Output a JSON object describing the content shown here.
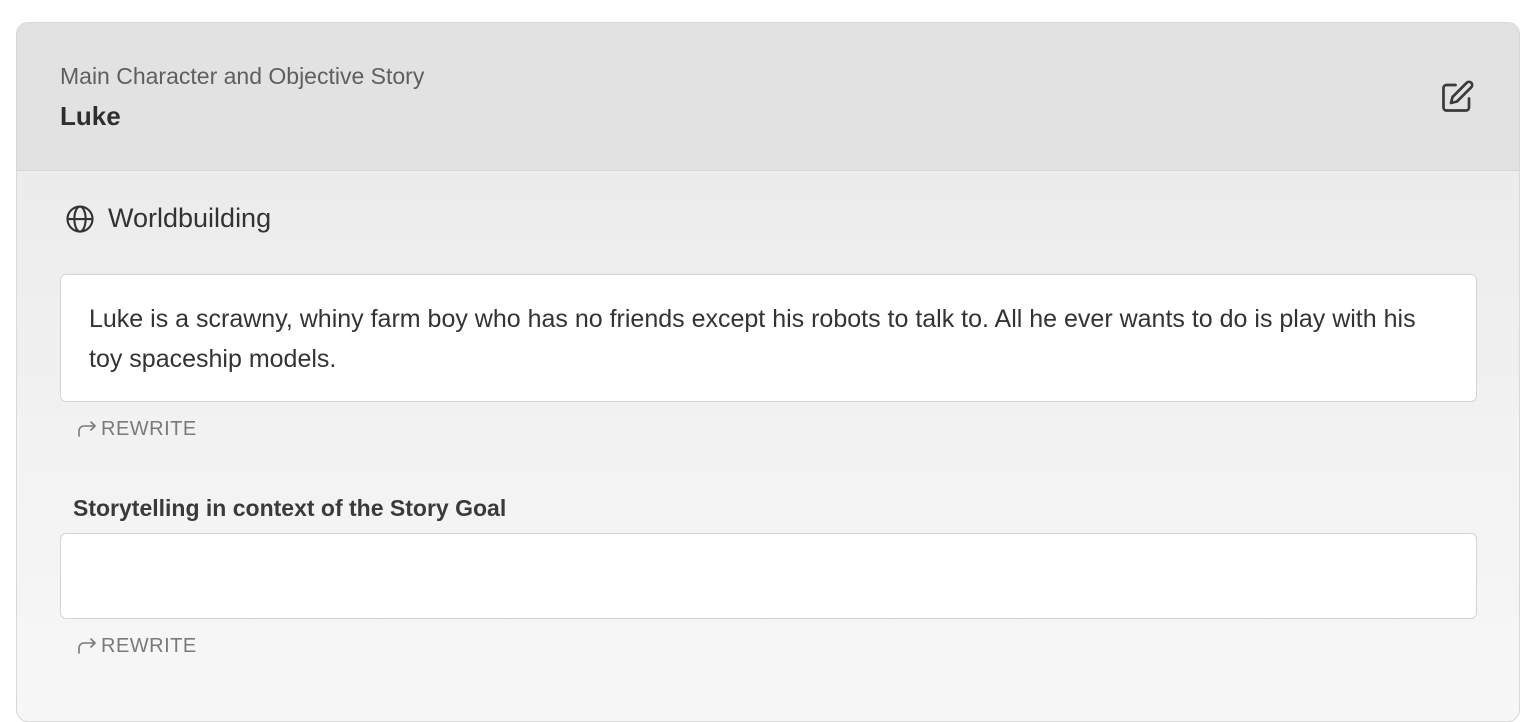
{
  "header": {
    "subtitle": "Main Character and Objective Story",
    "title": "Luke",
    "edit_icon": "edit-icon"
  },
  "worldbuilding": {
    "icon": "globe-icon",
    "label": "Worldbuilding",
    "text": "Luke is a scrawny, whiny farm boy who has no friends except his robots to talk to. All he ever wants to do is play with his toy spaceship models.",
    "rewrite_label": "REWRITE"
  },
  "storytelling": {
    "label": "Storytelling in context of the Story Goal",
    "value": "",
    "rewrite_label": "REWRITE"
  },
  "colors": {
    "header_bg": "#e2e2e2",
    "text": "#333333",
    "muted": "#7a7a7a"
  }
}
